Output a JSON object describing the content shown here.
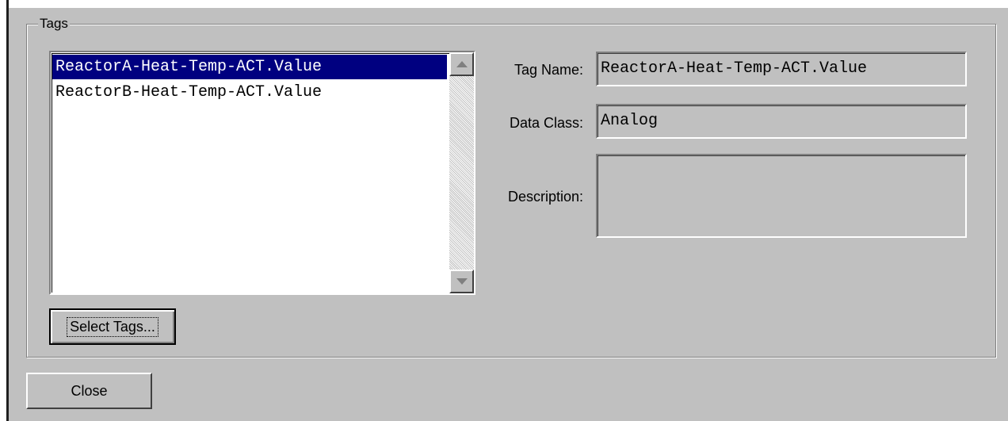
{
  "group": {
    "title": "Tags"
  },
  "tag_list": {
    "items": [
      {
        "label": "ReactorA-Heat-Temp-ACT.Value",
        "selected": true
      },
      {
        "label": "ReactorB-Heat-Temp-ACT.Value",
        "selected": false
      }
    ]
  },
  "buttons": {
    "select_tags": "Select Tags...",
    "close": "Close"
  },
  "details": {
    "tag_name_label": "Tag Name:",
    "tag_name_value": "ReactorA-Heat-Temp-ACT.Value",
    "data_class_label": "Data Class:",
    "data_class_value": "Analog",
    "description_label": "Description:",
    "description_value": ""
  },
  "colors": {
    "window_bg": "#c0c0c0",
    "selection_bg": "#000080",
    "selection_text": "#ffffff"
  },
  "icons": {
    "scroll_up": "chevron-up-icon",
    "scroll_down": "chevron-down-icon"
  }
}
